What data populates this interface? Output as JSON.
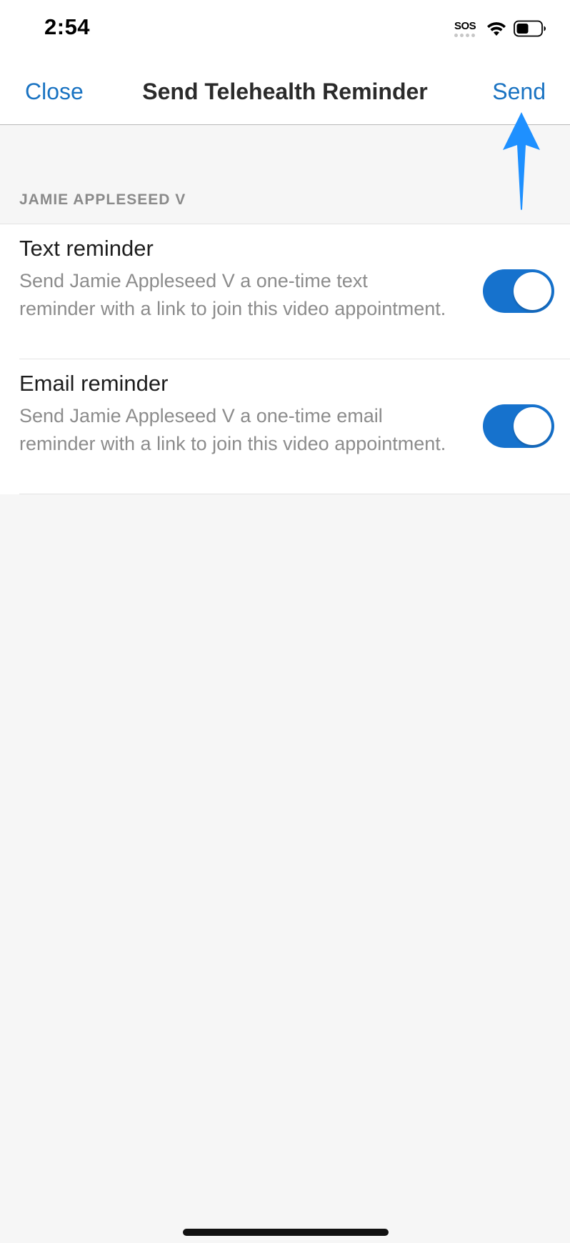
{
  "status_bar": {
    "time": "2:54",
    "sos": "SOS",
    "icons": [
      "wifi-icon",
      "battery-icon"
    ]
  },
  "nav": {
    "close_label": "Close",
    "title": "Send Telehealth Reminder",
    "send_label": "Send"
  },
  "section": {
    "header": "JAMIE APPLESEED V"
  },
  "reminders": [
    {
      "title": "Text reminder",
      "description": "Send Jamie Appleseed V a one-time text reminder with a link to join this video appointment.",
      "enabled": true
    },
    {
      "title": "Email reminder",
      "description": "Send Jamie Appleseed V a one-time email reminder with a link to join this video appointment.",
      "enabled": true
    }
  ],
  "colors": {
    "accent": "#1a73c2",
    "toggle_on": "#1672cd",
    "annotation_arrow": "#1e90ff",
    "background": "#f6f6f6"
  }
}
